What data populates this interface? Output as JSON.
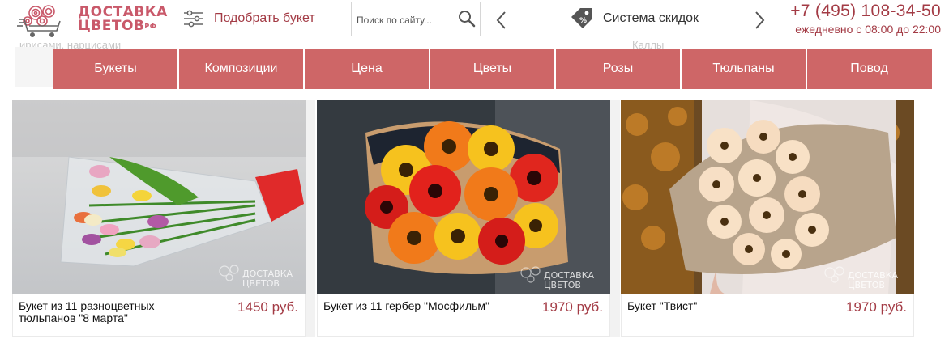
{
  "header": {
    "logo": {
      "line1": "ДОСТАВКА",
      "line2": "ЦВЕТОВ",
      "suffix": "РФ",
      "icon": "flower-cart-icon"
    },
    "pick_bouquet": {
      "label": "Подобрать букет",
      "icon": "sliders-icon"
    },
    "search": {
      "placeholder": "Поиск по сайту...",
      "icon": "search-icon"
    },
    "promo": {
      "label": "Система скидок",
      "icon": "discount-tag-icon",
      "prev_icon": "chevron-left-icon",
      "next_icon": "chevron-right-icon"
    },
    "phone": {
      "number": "+7 (495) 108-34-50",
      "hours": "ежедневно с 08:00 до 22:00"
    },
    "ghost_left": "ирисами, нарцисами",
    "ghost_right": "Каллы"
  },
  "nav": {
    "items": [
      {
        "label": "Букеты"
      },
      {
        "label": "Композиции"
      },
      {
        "label": "Цена"
      },
      {
        "label": "Цветы"
      },
      {
        "label": "Розы"
      },
      {
        "label": "Тюльпаны"
      },
      {
        "label": "Повод"
      }
    ]
  },
  "products": [
    {
      "name": "Букет из 11 разноцветных тюльпанов \"8 марта\"",
      "price": "1450 руб.",
      "watermark": "ДОСТАВКА ЦВЕТОВ"
    },
    {
      "name": "Букет из 11 гербер \"Мосфильм\"",
      "price": "1970 руб.",
      "watermark": "ДОСТАВКА ЦВЕТОВ"
    },
    {
      "name": "Букет \"Твист\"",
      "price": "1970 руб.",
      "watermark": "ДОСТАВКА ЦВЕТОВ"
    }
  ],
  "colors": {
    "brand": "#c9596a",
    "nav_bg": "#ce6667",
    "price": "#a33b45"
  }
}
